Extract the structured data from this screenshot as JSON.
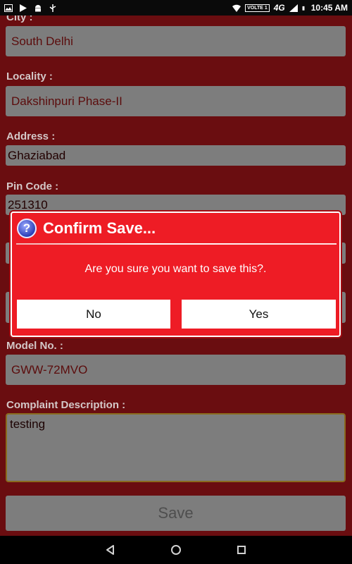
{
  "status_bar": {
    "left_icons": [
      "image-icon",
      "play-store-icon",
      "android-icon",
      "usb-icon"
    ],
    "volte_label": "VOLTE 1",
    "network_label": "4G",
    "time": "10:45 AM"
  },
  "form": {
    "city_label": "City :",
    "city_value": "South Delhi",
    "locality_label": "Locality :",
    "locality_value": "Dakshinpuri Phase-II",
    "address_label": "Address :",
    "address_value": "Ghaziabad",
    "pincode_label": "Pin Code :",
    "pincode_value": "251310",
    "model_label": "Model No. :",
    "model_value": "GWW-72MVO",
    "complaint_label": "Complaint Description :",
    "complaint_value": "testing",
    "save_label": "Save"
  },
  "dialog": {
    "title": "Confirm Save...",
    "message": "Are you sure you want to save this?.",
    "no_label": "No",
    "yes_label": "Yes",
    "icon": "help-icon"
  },
  "nav_bar": {
    "icons": [
      "back-icon",
      "home-icon",
      "recents-icon"
    ]
  },
  "colors": {
    "dialog_bg": "#ee1c25",
    "form_bg_dimmed": "#6a0d10",
    "field_bg": "#7d7d7d"
  }
}
